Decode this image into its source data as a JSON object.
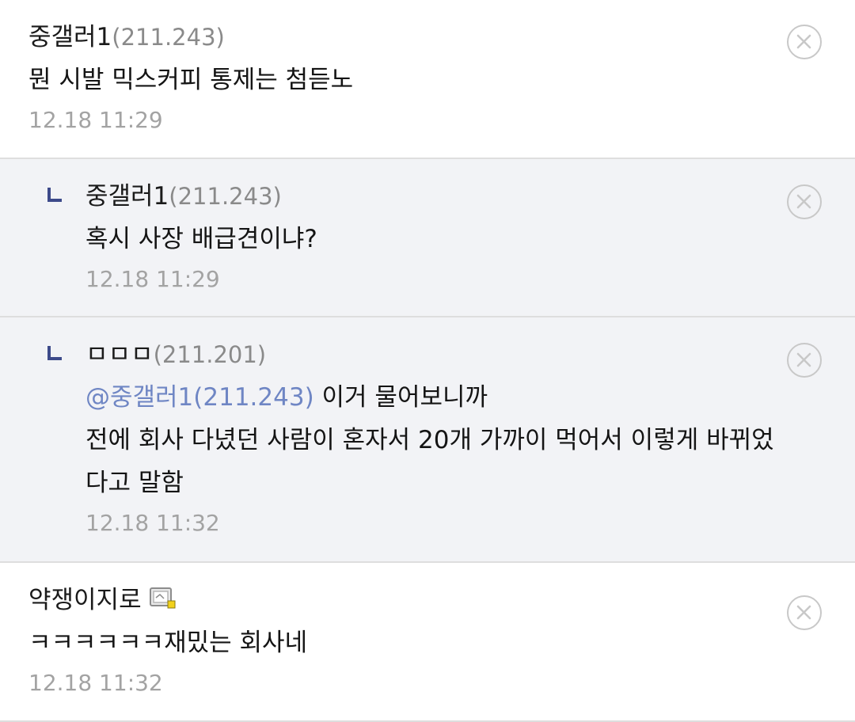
{
  "comments": [
    {
      "nick": "중갤러1",
      "ip": "(211.243)",
      "mention": "",
      "lines": [
        "뭔 시발 믹스커피 통제는 첨듣노"
      ],
      "date": "12.18 11:29"
    },
    {
      "nick": "중갤러1",
      "ip": "(211.243)",
      "mention": "",
      "lines": [
        "혹시 사장 배급견이냐?"
      ],
      "date": "12.18 11:29"
    },
    {
      "nick": "ㅁㅁㅁ",
      "ip": "(211.201)",
      "mention": "@중갤러1(211.243)",
      "lines": [
        " 이거 물어보니까",
        "전에 회사 다녔던 사람이 혼자서 20개 가까이 먹어서 이렇게 바뀌었",
        "다고 말함"
      ],
      "date": "12.18 11:32"
    },
    {
      "nick": "약쟁이지로",
      "ip": "",
      "mention": "",
      "lines": [
        "ㅋㅋㅋㅋㅋㅋ재밌는 회사네"
      ],
      "date": "12.18 11:32"
    }
  ],
  "icons": {
    "reply": "reply-arrow-icon",
    "delete": "delete-circle-x-icon",
    "gallery": "fixed-nick-gallery-icon"
  },
  "colors": {
    "reply_background": "#f2f3f6",
    "mention": "#6f86c4",
    "reply_mark": "#3d4a8a"
  }
}
